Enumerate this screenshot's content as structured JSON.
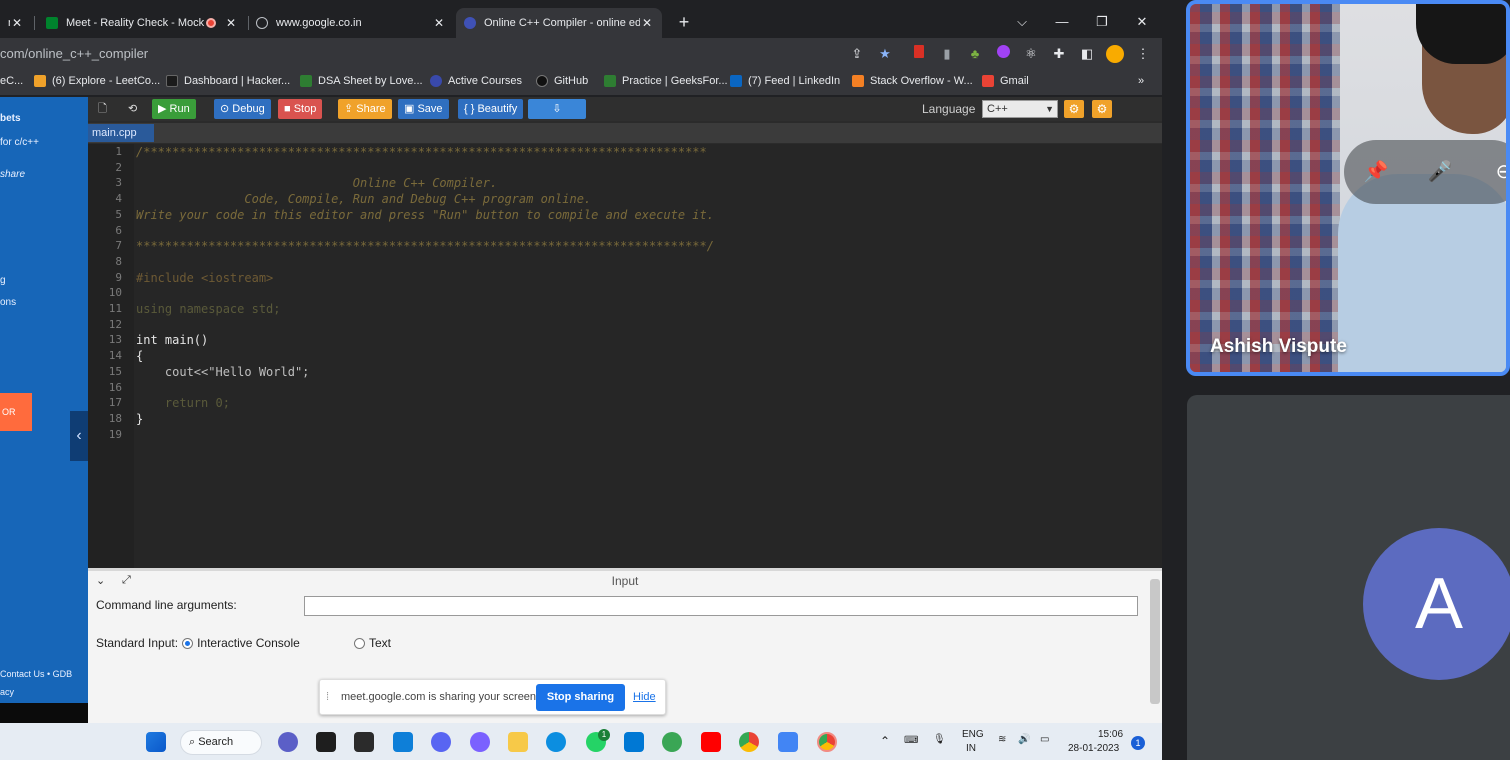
{
  "browser": {
    "tabs": [
      {
        "title": "nd",
        "active": false
      },
      {
        "title": "Meet - Reality Check - Mock",
        "active": false,
        "recording": true
      },
      {
        "title": "www.google.co.in",
        "active": false
      },
      {
        "title": "Online C++ Compiler - online ed",
        "active": true
      }
    ],
    "new_tab_icon": "+",
    "url": "com/online_c++_compiler",
    "bookmarks": [
      {
        "label": "eC...",
        "color": "#1e88e5"
      },
      {
        "label": "(6) Explore - LeetCo...",
        "color": "#f0a22a"
      },
      {
        "label": "Dashboard | Hacker...",
        "color": "#1b1b1b"
      },
      {
        "label": "DSA Sheet by Love...",
        "color": "#2e7d32"
      },
      {
        "label": "Active Courses",
        "color": "#3949ab"
      },
      {
        "label": "GitHub",
        "color": "#111111"
      },
      {
        "label": "Practice | GeeksFor...",
        "color": "#2e7d32"
      },
      {
        "label": "(7) Feed | LinkedIn",
        "color": "#0a66c2"
      },
      {
        "label": "Stack Overflow - W...",
        "color": "#f48024"
      },
      {
        "label": "Gmail",
        "color": "#ea4335"
      }
    ],
    "bookmarks_more": "»"
  },
  "left_nav": {
    "items": [
      "bets",
      "for c/c++",
      "share",
      "g",
      "ons"
    ],
    "orange_button": "OR",
    "footer": [
      "Contact Us • GDB",
      "acy"
    ]
  },
  "gdb_toolbar": {
    "buttons": [
      {
        "label": "Run",
        "icon": "▶",
        "color": "#3a9d3a"
      },
      {
        "label": "Debug",
        "icon": "⊙",
        "color": "#2f6fc0"
      },
      {
        "label": "Stop",
        "icon": "■",
        "color": "#d9534f"
      },
      {
        "label": "Share",
        "icon": "⇪",
        "color": "#f0a22a"
      },
      {
        "label": "Save",
        "icon": "🖫",
        "color": "#2f6fc0"
      },
      {
        "label": "Beautify",
        "icon": "{ }",
        "color": "#2f6fc0"
      },
      {
        "label": "",
        "icon": "⇩",
        "color": "#3a86d8"
      }
    ],
    "language_label": "Language",
    "language_value": "C++"
  },
  "file_tab": "main.cpp",
  "code_lines": [
    {
      "n": "1",
      "text": "/******************************************************************************",
      "cls": "c-cmt"
    },
    {
      "n": "2",
      "text": "",
      "cls": ""
    },
    {
      "n": "3",
      "text": "                              Online C++ Compiler.",
      "cls": "c-cmt"
    },
    {
      "n": "4",
      "text": "               Code, Compile, Run and Debug C++ program online.",
      "cls": "c-cmt"
    },
    {
      "n": "5",
      "text": "Write your code in this editor and press \"Run\" button to compile and execute it.",
      "cls": "c-cmt"
    },
    {
      "n": "6",
      "text": "",
      "cls": ""
    },
    {
      "n": "7",
      "text": "*******************************************************************************/",
      "cls": "c-cmt"
    },
    {
      "n": "8",
      "text": "",
      "cls": ""
    },
    {
      "n": "9",
      "text": "#include <iostream>",
      "cls": "c-pre"
    },
    {
      "n": "10",
      "text": "",
      "cls": ""
    },
    {
      "n": "11",
      "text": "using namespace std;",
      "cls": "c-kw"
    },
    {
      "n": "12",
      "text": "",
      "cls": ""
    },
    {
      "n": "13",
      "text": "int main()",
      "cls": ""
    },
    {
      "n": "14",
      "text": "{",
      "cls": ""
    },
    {
      "n": "15",
      "text": "    cout<<\"Hello World\";",
      "cls": "c-str"
    },
    {
      "n": "16",
      "text": "",
      "cls": ""
    },
    {
      "n": "17",
      "text": "    return 0;",
      "cls": "c-kw"
    },
    {
      "n": "18",
      "text": "}",
      "cls": ""
    },
    {
      "n": "19",
      "text": "",
      "cls": ""
    }
  ],
  "input_panel": {
    "title": "Input",
    "cla_label": "Command line arguments:",
    "cla_value": "",
    "si_label": "Standard Input:",
    "opt_interactive": "Interactive Console",
    "opt_text": "Text",
    "selected": "Interactive Console"
  },
  "share_notice": {
    "text": "meet.google.com is sharing your screen.",
    "stop_label": "Stop sharing",
    "hide_label": "Hide"
  },
  "taskbar": {
    "search_label": "Search",
    "lang_top": "ENG",
    "lang_bottom": "IN",
    "time": "15:06",
    "date": "28-01-2023",
    "notifications": "1",
    "whatsapp_badge": "1"
  },
  "meet": {
    "participant_name": "Ashish Vispute",
    "avatar_letter": "A",
    "accent_color": "#4a8af4",
    "avatar_color": "#5c6bc0"
  }
}
